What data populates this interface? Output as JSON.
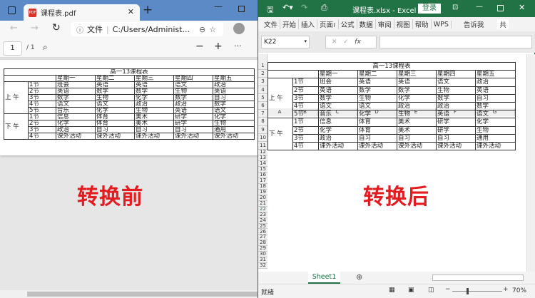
{
  "browser": {
    "tab_title": "课程表.pdf",
    "address_prefix": "文件",
    "address": "C:/Users/Administ...",
    "page_current": "1",
    "page_total": "/ 1"
  },
  "labels": {
    "before": "转换前",
    "after": "转换后"
  },
  "schedule": {
    "title": "高一13课程表",
    "days": [
      "星期一",
      "星期二",
      "星期三",
      "星期四",
      "星期五"
    ],
    "groups": [
      {
        "name": "上 午",
        "rows": [
          {
            "period": "1节",
            "classes": [
              "班会",
              "英语",
              "英语",
              "语文",
              "政治"
            ]
          },
          {
            "period": "2节",
            "classes": [
              "英语",
              "数学",
              "数学",
              "生物",
              "英语"
            ]
          },
          {
            "period": "3节",
            "classes": [
              "数学",
              "生物",
              "化学",
              "数学",
              "自习"
            ]
          },
          {
            "period": "4节",
            "classes": [
              "语文",
              "语文",
              "政治",
              "政治",
              "数学"
            ]
          },
          {
            "period": "5节",
            "classes": [
              "音乐",
              "化学",
              "生物",
              "英语",
              "语文"
            ]
          }
        ]
      },
      {
        "name": "下 午",
        "rows": [
          {
            "period": "1节",
            "classes": [
              "信息",
              "体育",
              "美术",
              "研学",
              "化学"
            ]
          },
          {
            "period": "2节",
            "classes": [
              "化学",
              "体育",
              "美术",
              "研学",
              "生物"
            ]
          },
          {
            "period": "3节",
            "classes": [
              "政治",
              "自习",
              "自习",
              "自习",
              "通用"
            ]
          },
          {
            "period": "4节",
            "classes": [
              "课外活动",
              "课外活动",
              "课外活动",
              "课外活动",
              "课外活动"
            ]
          }
        ]
      }
    ]
  },
  "excel": {
    "title": "课程表.xlsx  -  Excel",
    "login": "登录",
    "ribbon": [
      "文件",
      "开始",
      "插入",
      "页面≀",
      "公式",
      "数据",
      "审阅",
      "视图",
      "帮助",
      "WPS"
    ],
    "tell_me": "告诉我",
    "share": "共",
    "name_box": "K22",
    "fx": "fx",
    "columns": [
      "A",
      "B",
      "C",
      "D",
      "E",
      "F",
      "G"
    ],
    "sheet_tab": "Sheet1",
    "status": "就绪",
    "zoom": "70%"
  },
  "colors": {
    "excel_green": "#217346",
    "edge_blue": "#5b8ac7",
    "label_red": "#e41b1f"
  }
}
